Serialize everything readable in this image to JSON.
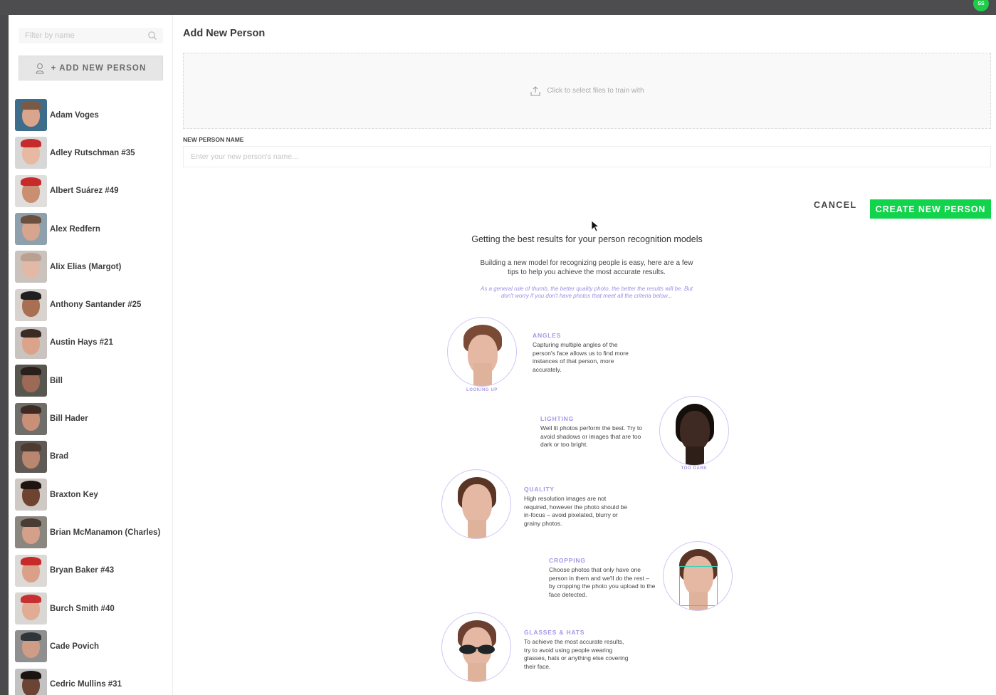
{
  "user": {
    "initials": "SS"
  },
  "sidebar": {
    "filter_placeholder": "Filter by name",
    "add_button_label": "+ ADD NEW PERSON",
    "people": [
      {
        "name": "Adam Voges"
      },
      {
        "name": "Adley Rutschman #35"
      },
      {
        "name": "Albert Suárez #49"
      },
      {
        "name": "Alex Redfern"
      },
      {
        "name": "Alix Elias (Margot)"
      },
      {
        "name": "Anthony Santander #25"
      },
      {
        "name": "Austin Hays #21"
      },
      {
        "name": "Bill"
      },
      {
        "name": "Bill Hader"
      },
      {
        "name": "Brad"
      },
      {
        "name": "Braxton Key"
      },
      {
        "name": "Brian McManamon (Charles)"
      },
      {
        "name": "Bryan Baker #43"
      },
      {
        "name": "Burch Smith #40"
      },
      {
        "name": "Cade Povich"
      },
      {
        "name": "Cedric Mullins #31"
      }
    ]
  },
  "main": {
    "title": "Add New Person",
    "dropzone_text": "Click to select files to train with",
    "name_label": "NEW PERSON NAME",
    "name_placeholder": "Enter your new person's name...",
    "name_value": "",
    "cancel_label": "CANCEL",
    "create_label": "CREATE NEW PERSON"
  },
  "tips": {
    "title": "Getting the best results for your person recognition models",
    "intro": "Building a new model for recognizing people is easy, here are a few tips to help you achieve the most accurate results.",
    "note": "As a general rule of thumb, the better quality photo, the better the results will be. But don't worry if you don't have photos that meet all the criteria below...",
    "items": [
      {
        "heading": "ANGLES",
        "caption": "LOOKING UP",
        "body": "Capturing multiple angles of the person's face allows us to find more instances of that person, more accurately."
      },
      {
        "heading": "LIGHTING",
        "caption": "TOO DARK",
        "body": "Well lit photos perform the best. Try to avoid shadows or images that are too dark or too bright."
      },
      {
        "heading": "QUALITY",
        "caption": "",
        "body": "High resolution images are not required, however the photo should be in-focus – avoid pixelated, blurry or grainy photos."
      },
      {
        "heading": "CROPPING",
        "caption": "",
        "body": "Choose photos that only have one person in them and we'll do the rest – by cropping the photo you upload to the face detected."
      },
      {
        "heading": "GLASSES & HATS",
        "caption": "",
        "body": "To achieve the most accurate results, try to avoid using people wearing glasses, hats or anything else covering their face."
      }
    ]
  },
  "colors": {
    "accent_green": "#12d44c",
    "tip_purple": "#a497e6",
    "avatar_badge_green": "#1fcc4a"
  },
  "icons": [
    "search-icon",
    "add-person-icon",
    "upload-icon",
    "cursor-pointer-icon"
  ]
}
